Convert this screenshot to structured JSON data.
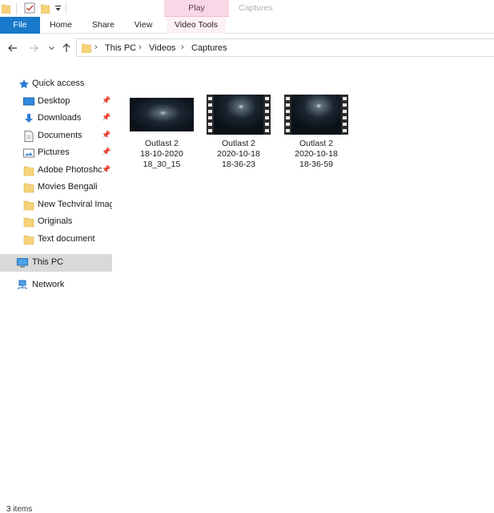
{
  "window": {
    "contextual_tab": "Play",
    "contextual_title": "Captures"
  },
  "ribbon": {
    "tabs": [
      "File",
      "Home",
      "Share",
      "View",
      "Video Tools"
    ]
  },
  "address": {
    "breadcrumb": [
      "This PC",
      "Videos",
      "Captures"
    ]
  },
  "navpane": {
    "items": [
      {
        "label": "Quick access",
        "icon": "star-icon"
      },
      {
        "label": "Desktop",
        "icon": "desktop-icon",
        "pinned": true
      },
      {
        "label": "Downloads",
        "icon": "download-icon",
        "pinned": true
      },
      {
        "label": "Documents",
        "icon": "document-icon",
        "pinned": true
      },
      {
        "label": "Pictures",
        "icon": "pictures-icon",
        "pinned": true
      },
      {
        "label": "Adobe Photoshc",
        "icon": "folder-icon",
        "pinned": true
      },
      {
        "label": "Movies Bengali",
        "icon": "folder-icon"
      },
      {
        "label": "New Techviral Imag",
        "icon": "folder-icon"
      },
      {
        "label": "Originals",
        "icon": "folder-icon"
      },
      {
        "label": "Text document",
        "icon": "folder-icon"
      },
      {
        "label": "This PC",
        "icon": "computer-icon",
        "selected": true
      },
      {
        "label": "Network",
        "icon": "network-icon"
      }
    ]
  },
  "files": [
    {
      "line1": "Outlast 2",
      "line2": "18-10-2020",
      "line3": "18_30_15",
      "thumb": "plain"
    },
    {
      "line1": "Outlast 2",
      "line2": "2020-10-18",
      "line3": "18-36-23",
      "thumb": "filmstrip"
    },
    {
      "line1": "Outlast 2",
      "line2": "2020-10-18",
      "line3": "18-36-59",
      "thumb": "filmstrip"
    }
  ],
  "statusbar": {
    "text": "3 items"
  },
  "colors": {
    "accent": "#1979ca",
    "contextual_tab_bg": "#f8d7e6",
    "folder": "#f6d37a",
    "selected_bg": "#d9d9d9"
  }
}
